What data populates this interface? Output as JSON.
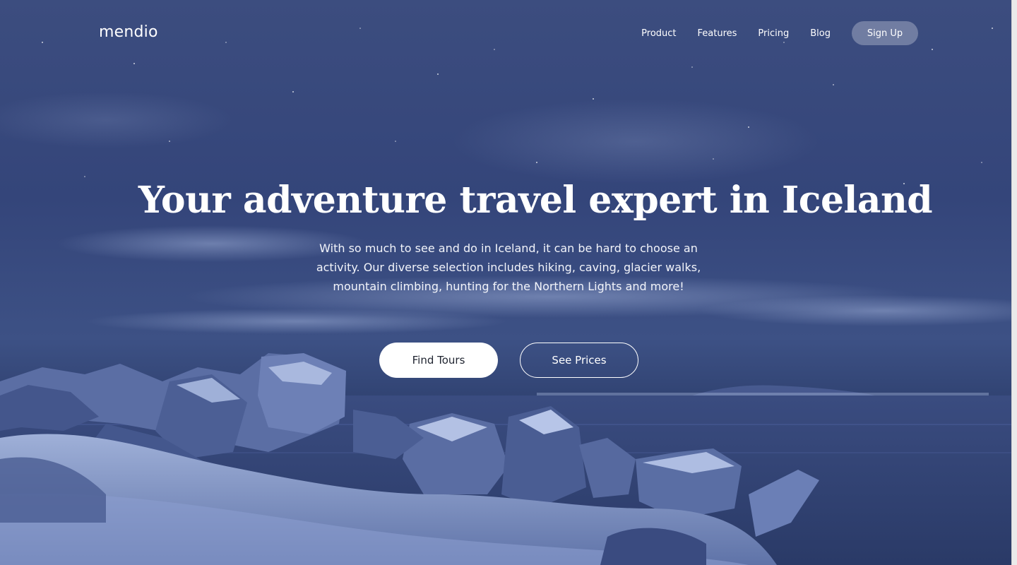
{
  "nav": {
    "logo": "mendio",
    "links": [
      "Product",
      "Features",
      "Pricing",
      "Blog"
    ],
    "signup_label": "Sign Up"
  },
  "hero": {
    "title": "Your adventure travel expert in Iceland",
    "description": "With so much to see and do in Iceland, it can be hard to choose an activity. Our diverse selection includes hiking, caving, glacier walks, mountain climbing, hunting for the Northern Lights and more!",
    "primary_cta": "Find Tours",
    "secondary_cta": "See Prices"
  },
  "colors": {
    "overlay_blue": "#34477a",
    "button_text": "#1f2430",
    "white": "#ffffff"
  }
}
